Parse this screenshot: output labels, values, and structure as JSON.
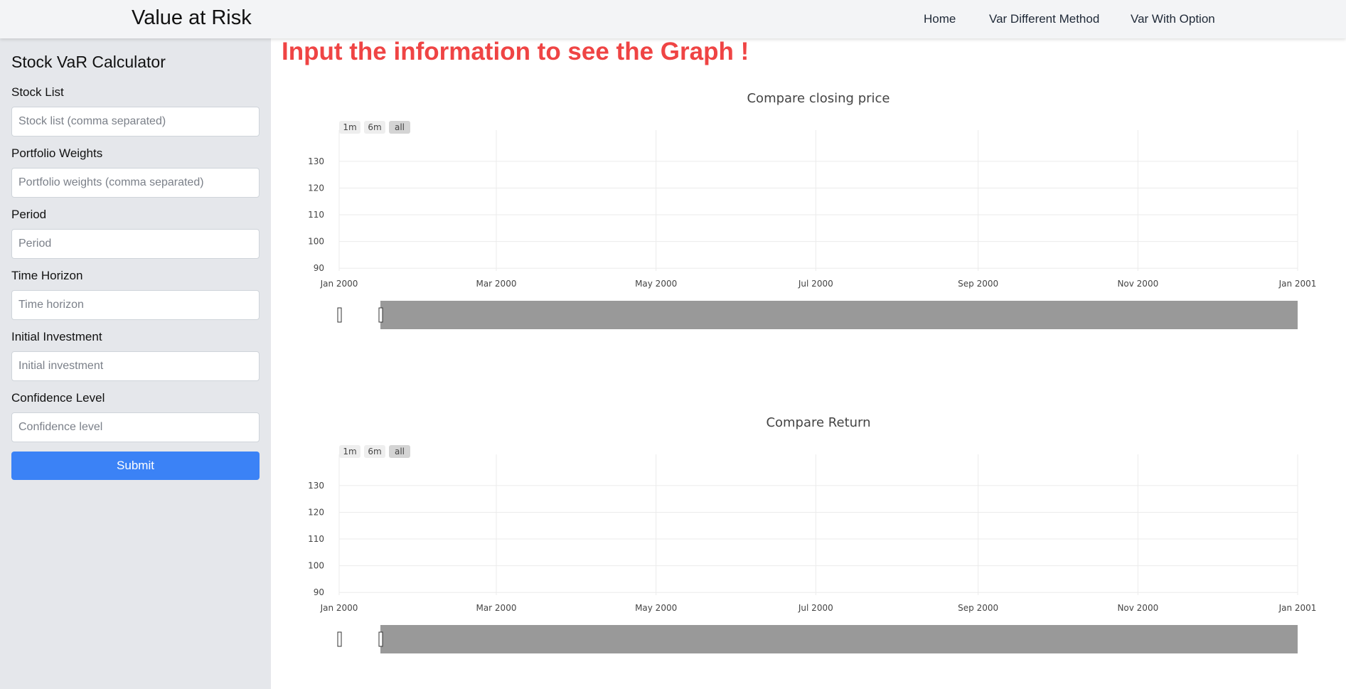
{
  "navbar": {
    "brand": "Value at Risk",
    "links": [
      "Home",
      "Var Different Method",
      "Var With Option"
    ]
  },
  "sidebar": {
    "title": "Stock VaR Calculator",
    "fields": [
      {
        "label": "Stock List",
        "placeholder": "Stock list (comma separated)"
      },
      {
        "label": "Portfolio Weights",
        "placeholder": "Portfolio weights (comma separated)"
      },
      {
        "label": "Period",
        "placeholder": "Period"
      },
      {
        "label": "Time Horizon",
        "placeholder": "Time horizon"
      },
      {
        "label": "Initial Investment",
        "placeholder": "Initial investment"
      },
      {
        "label": "Confidence Level",
        "placeholder": "Confidence level"
      }
    ],
    "submit_label": "Submit"
  },
  "main": {
    "heading": "Input the information to see the Graph !"
  },
  "colors": {
    "accent": "#3b82f6",
    "heading": "#ef4444",
    "rangeslider": "#999999",
    "selector_active": "#d4d4d4",
    "selector_inactive": "#eeeeee"
  },
  "chart_data": [
    {
      "type": "line",
      "title": "Compare closing price",
      "xlabel": "",
      "ylabel": "",
      "series": [],
      "x_ticks": [
        "Jan 2000",
        "Mar 2000",
        "May 2000",
        "Jul 2000",
        "Sep 2000",
        "Nov 2000",
        "Jan 2001"
      ],
      "y_ticks": [
        90,
        100,
        110,
        120,
        130
      ],
      "xlim": [
        "2000-01-01",
        "2001-01-01"
      ],
      "ylim": [
        89,
        139
      ],
      "grid": true,
      "range_selector": [
        "1m",
        "6m",
        "all"
      ],
      "range_selector_active": "all",
      "range_slider": true
    },
    {
      "type": "line",
      "title": "Compare Return",
      "xlabel": "",
      "ylabel": "",
      "series": [],
      "x_ticks": [
        "Jan 2000",
        "Mar 2000",
        "May 2000",
        "Jul 2000",
        "Sep 2000",
        "Nov 2000",
        "Jan 2001"
      ],
      "y_ticks": [
        90,
        100,
        110,
        120,
        130
      ],
      "xlim": [
        "2000-01-01",
        "2001-01-01"
      ],
      "ylim": [
        89,
        139
      ],
      "grid": true,
      "range_selector": [
        "1m",
        "6m",
        "all"
      ],
      "range_selector_active": "all",
      "range_slider": true
    }
  ]
}
